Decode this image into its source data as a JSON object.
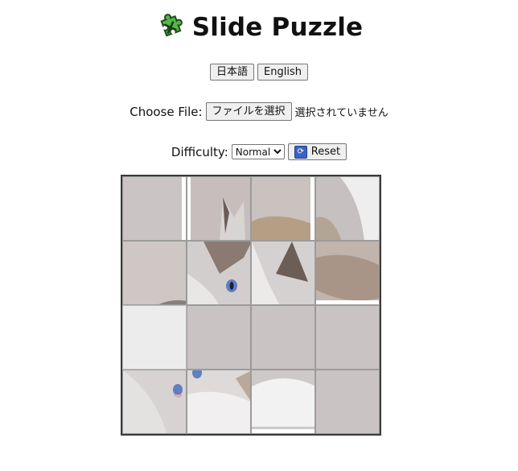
{
  "header": {
    "title": "Slide Puzzle",
    "icon": "puzzle-piece-icon"
  },
  "language": {
    "japanese_label": "日本語",
    "english_label": "English"
  },
  "file": {
    "label": "Choose File:",
    "button_label": "ファイルを選択",
    "status": "選択されていません"
  },
  "difficulty": {
    "label": "Difficulty:",
    "selected": "Normal",
    "reset_label": "Reset",
    "reset_icon": "refresh-icon"
  },
  "board": {
    "grid": "4x4",
    "empty_tile": {
      "row": 2,
      "col": 0
    },
    "colors": {
      "border": "#3a3a3a",
      "tile_border": "#9b9b9b",
      "empty": "#ececec"
    }
  }
}
